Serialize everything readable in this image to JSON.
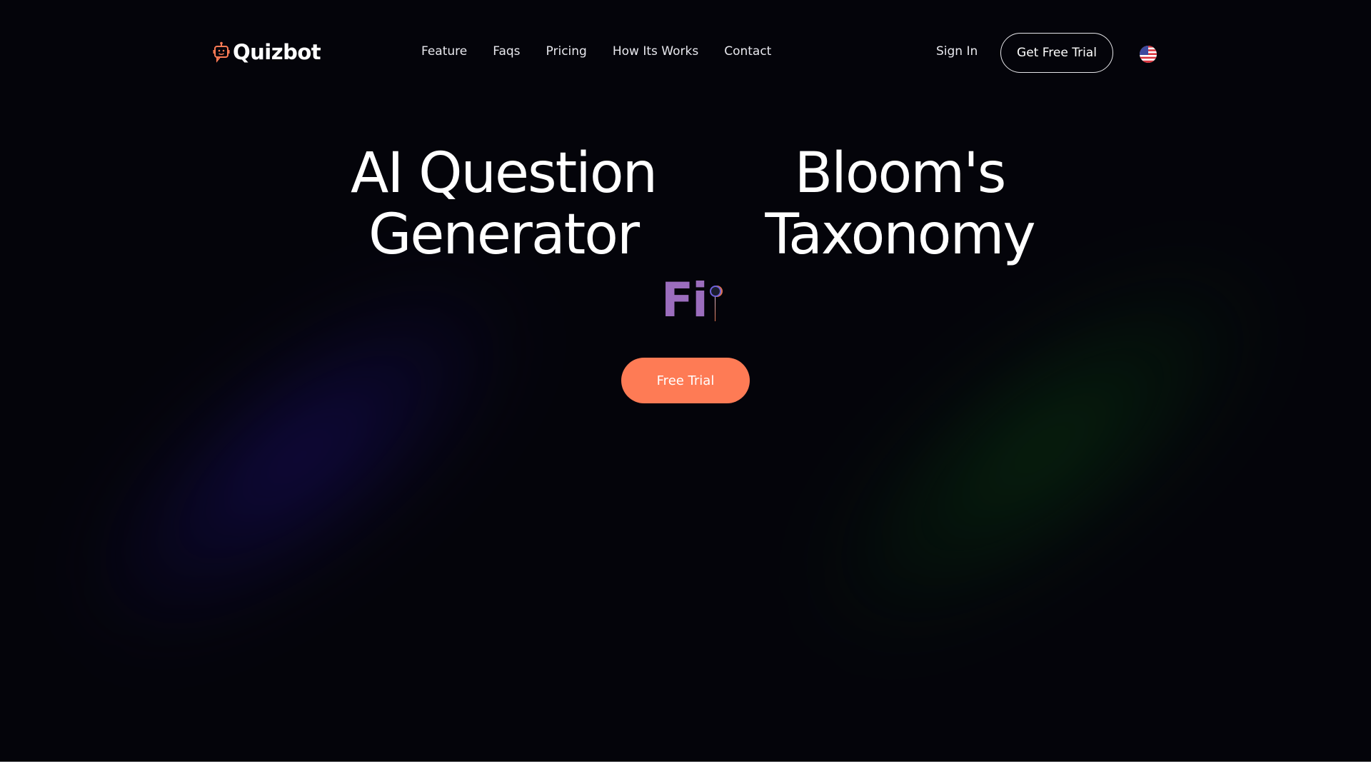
{
  "brand": {
    "name": "Quizbot",
    "logo_icon": "robot-chat-icon",
    "accent": "#fe7b55"
  },
  "nav": {
    "items": [
      {
        "label": "Feature"
      },
      {
        "label": "Faqs"
      },
      {
        "label": "Pricing"
      },
      {
        "label": "How Its Works"
      },
      {
        "label": "Contact"
      }
    ],
    "sign_in": "Sign In",
    "get_free_trial": "Get Free Trial",
    "language_flag": "us-flag-icon"
  },
  "hero": {
    "left_heading": [
      "AI Question",
      "Generator"
    ],
    "right_heading": [
      "Bloom's",
      "Taxonomy"
    ],
    "typing_text": "Fi",
    "typing_color": "#9b6dbd",
    "cta_label": "Free Trial"
  }
}
